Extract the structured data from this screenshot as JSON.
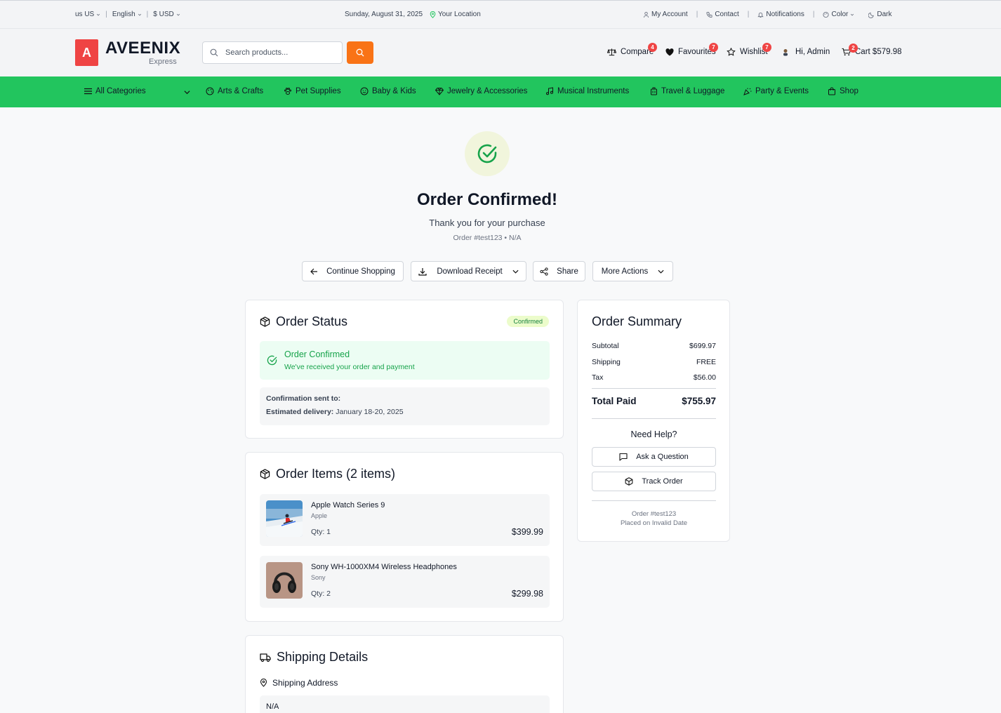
{
  "topbar": {
    "region": "us US",
    "language": "English",
    "currency": "$ USD",
    "date": "Sunday, August 31, 2025",
    "location": "Your Location",
    "account": "My Account",
    "contact": "Contact",
    "notifications": "Notifications",
    "color": "Color",
    "dark": "Dark"
  },
  "header": {
    "logo_letter": "A",
    "brand": "AVEENIX",
    "brand_sub": "Express",
    "search_placeholder": "Search products...",
    "compare": "Compare",
    "compare_count": "4",
    "favourites": "Favourites",
    "favourites_count": "7",
    "wishlist": "Wishlist",
    "wishlist_count": "7",
    "user": "Hi, Admin",
    "cart": "Cart $579.98",
    "cart_count": "2"
  },
  "categories": {
    "all": "All Categories",
    "items": [
      "Arts & Crafts",
      "Pet Supplies",
      "Baby & Kids",
      "Jewelry & Accessories",
      "Musical Instruments",
      "Travel & Luggage",
      "Party & Events",
      "Shop"
    ]
  },
  "hero": {
    "title": "Order Confirmed!",
    "subtitle": "Thank you for your purchase",
    "order_line": "Order #test123 • N/A"
  },
  "actions": {
    "continue": "Continue Shopping",
    "download": "Download Receipt",
    "share": "Share",
    "more": "More Actions"
  },
  "status": {
    "title": "Order Status",
    "badge": "Confirmed",
    "alert_title": "Order Confirmed",
    "alert_text": "We've received your order and payment",
    "sent_label": "Confirmation sent to:",
    "delivery_label": "Estimated delivery:",
    "delivery_value": "January 18-20, 2025"
  },
  "items": {
    "title": "Order Items (2 items)",
    "list": [
      {
        "name": "Apple Watch Series 9",
        "brand": "Apple",
        "qty": "Qty: 1",
        "price": "$399.99"
      },
      {
        "name": "Sony WH-1000XM4 Wireless Headphones",
        "brand": "Sony",
        "qty": "Qty: 2",
        "price": "$299.98"
      }
    ]
  },
  "shipping": {
    "title": "Shipping Details",
    "address_label": "Shipping Address",
    "address_value": "N/A"
  },
  "summary": {
    "title": "Order Summary",
    "subtotal_label": "Subtotal",
    "subtotal": "$699.97",
    "shipping_label": "Shipping",
    "shipping": "FREE",
    "tax_label": "Tax",
    "tax": "$56.00",
    "total_label": "Total Paid",
    "total": "$755.97",
    "help": "Need Help?",
    "ask": "Ask a Question",
    "track": "Track Order",
    "order_ref": "Order #test123",
    "placed": "Placed on Invalid Date"
  },
  "colors": {
    "accent_green": "#22c55e",
    "brand_red": "#ef4444",
    "search_orange": "#f97316"
  }
}
